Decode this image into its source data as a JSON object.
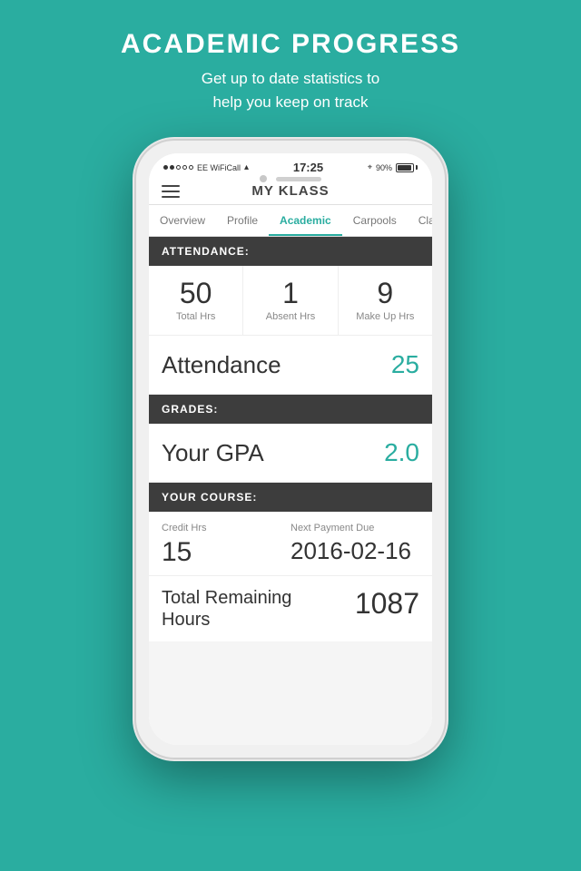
{
  "background_color": "#2aada0",
  "header": {
    "title": "ACADEMIC PROGRESS",
    "subtitle": "Get up to date statistics to\nhelp you keep on track"
  },
  "status_bar": {
    "carrier": "●●○○○ EE WiFiCall",
    "wifi": "▲",
    "time": "17:25",
    "battery_percent": "90%"
  },
  "app": {
    "title": "MY KLASS"
  },
  "tabs": [
    {
      "label": "Overview",
      "active": false
    },
    {
      "label": "Profile",
      "active": false
    },
    {
      "label": "Academic",
      "active": true
    },
    {
      "label": "Carpools",
      "active": false
    },
    {
      "label": "Cla...",
      "active": false
    }
  ],
  "attendance_section": {
    "header": "ATTENDANCE:",
    "stats": [
      {
        "value": "50",
        "label": "Total Hrs"
      },
      {
        "value": "1",
        "label": "Absent Hrs"
      },
      {
        "value": "9",
        "label": "Make Up Hrs"
      }
    ],
    "summary_label": "Attendance",
    "summary_value": "25"
  },
  "grades_section": {
    "header": "GRADES:",
    "gpa_label": "Your GPA",
    "gpa_value": "2.0"
  },
  "course_section": {
    "header": "YOUR COURSE:",
    "credit_label": "Credit Hrs",
    "credit_value": "15",
    "payment_label": "Next Payment Due",
    "payment_value": "2016-02-16"
  },
  "total_section": {
    "label": "Total Remaining\nHours",
    "value": "1087"
  }
}
